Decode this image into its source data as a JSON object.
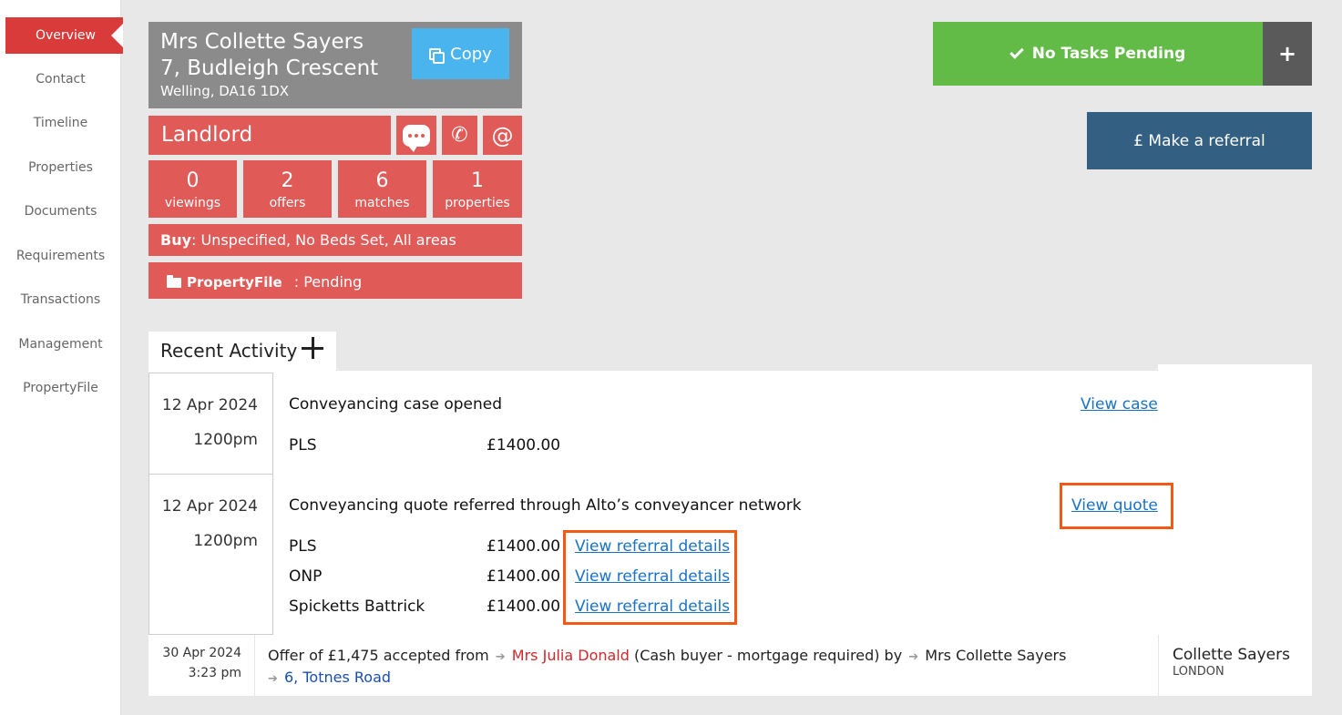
{
  "sidebar": {
    "items": [
      {
        "label": "Overview",
        "active": true
      },
      {
        "label": "Contact"
      },
      {
        "label": "Timeline"
      },
      {
        "label": "Properties"
      },
      {
        "label": "Documents"
      },
      {
        "label": "Requirements"
      },
      {
        "label": "Transactions"
      },
      {
        "label": "Management"
      },
      {
        "label": "PropertyFile"
      }
    ]
  },
  "contact": {
    "name": "Mrs Collette Sayers",
    "address_line1": "7, Budleigh Crescent",
    "address_line2": "Welling, DA16 1DX",
    "copy_label": "Copy",
    "role": "Landlord",
    "stats": [
      {
        "value": "0",
        "label": "viewings"
      },
      {
        "value": "2",
        "label": "offers"
      },
      {
        "value": "6",
        "label": "matches"
      },
      {
        "value": "1",
        "label": "properties"
      }
    ],
    "buy_label": "Buy",
    "buy_value": ": Unspecified, No Beds Set, All areas",
    "propertyfile_brand": "PropertyFile",
    "propertyfile_status": ": Pending"
  },
  "actions": {
    "tasks_label": "No Tasks Pending",
    "plus_label": "+",
    "referral_label": "£ Make a referral"
  },
  "recent_activity": {
    "title": "Recent Activity",
    "entries": [
      {
        "date": "12 Apr 2024",
        "time": "1200pm",
        "title": "Conveyancing case opened",
        "link": "View case",
        "lines": [
          {
            "name": "PLS",
            "amount": "£1400.00"
          }
        ]
      },
      {
        "date": "12 Apr 2024",
        "time": "1200pm",
        "title": "Conveyancing quote referred through Alto’s conveyancer network",
        "link": "View quote",
        "lines": [
          {
            "name": "PLS",
            "amount": "£1400.00",
            "link": "View referral details"
          },
          {
            "name": "ONP",
            "amount": "£1400.00",
            "link": "View referral details"
          },
          {
            "name": "Spicketts Battrick",
            "amount": "£1400.00",
            "link": "View referral details"
          }
        ]
      }
    ],
    "offer": {
      "date": "30 Apr 2024",
      "time": "3:23 pm",
      "text1": "Offer of £1,475 accepted from",
      "buyer": "Mrs Julia Donald",
      "text2": "(Cash buyer - mortgage required) by",
      "by": "Mrs Collette Sayers",
      "property": "6, Totnes Road",
      "side_name": "Collette Sayers",
      "side_location": "LONDON"
    }
  },
  "colors": {
    "brand_red": "#d93a3a",
    "card_red": "#e05a57",
    "green": "#62bb46",
    "navy": "#336082",
    "highlight": "#f05a14",
    "link": "#1a73c8"
  }
}
